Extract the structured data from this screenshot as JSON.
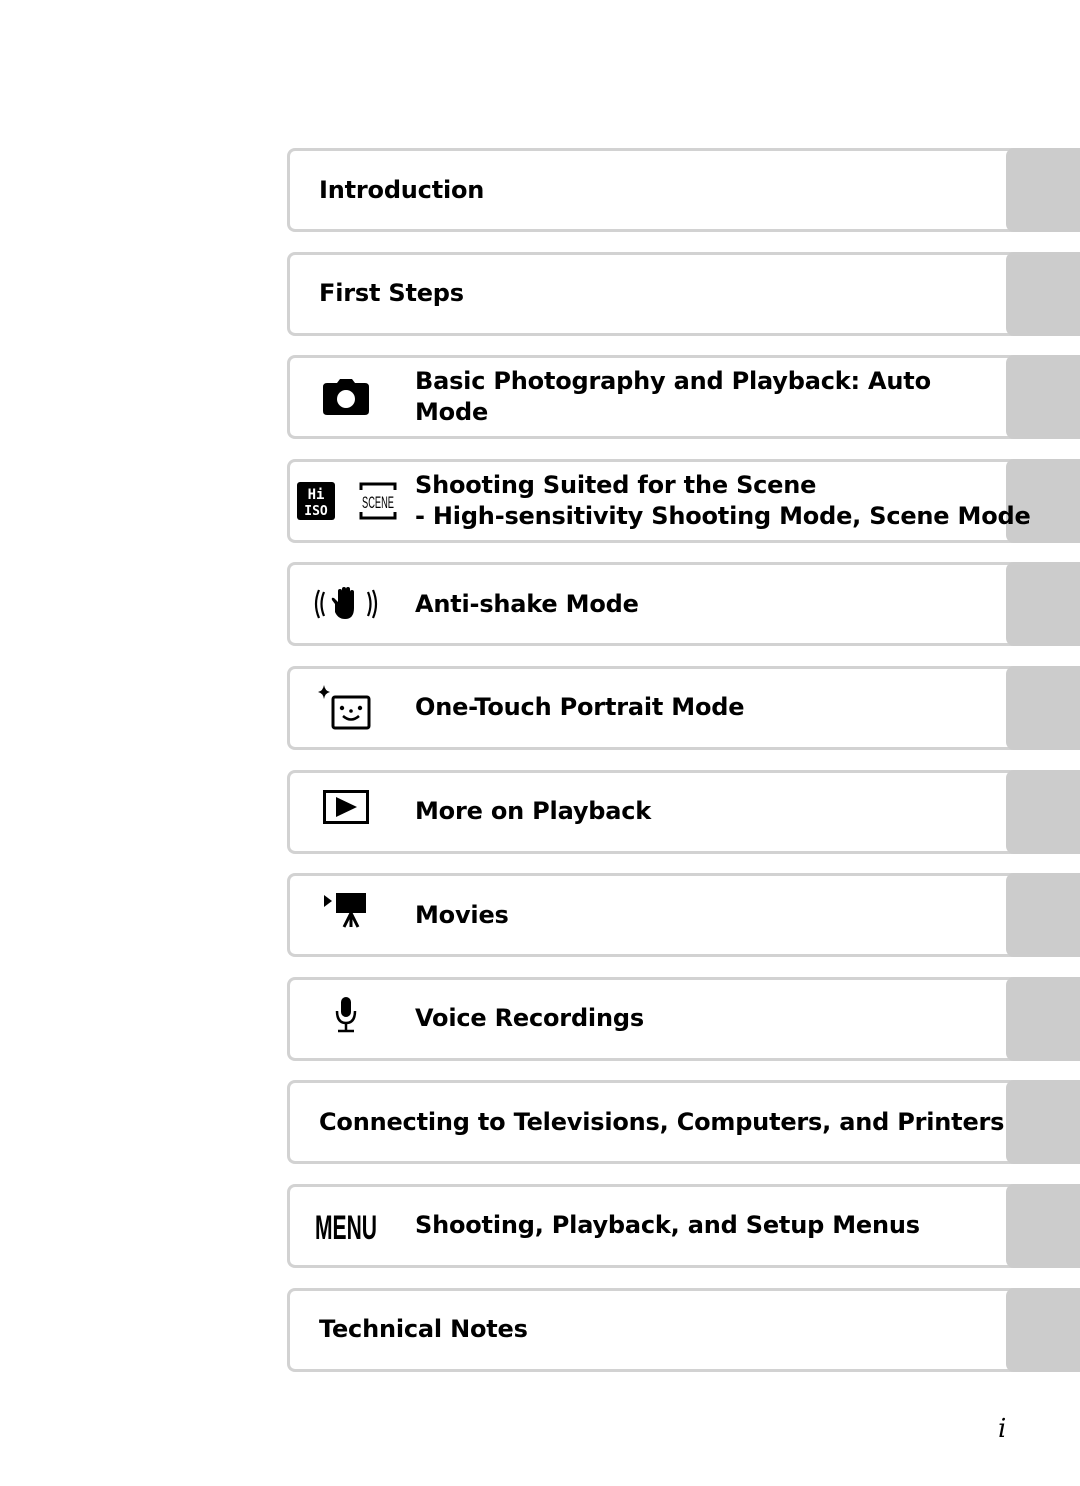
{
  "toc": {
    "entries": [
      {
        "title": "Introduction",
        "icon": null
      },
      {
        "title": "First Steps",
        "icon": null
      },
      {
        "title": "Basic Photography and Playback: Auto",
        "title2": "Mode",
        "icon": "camera-icon"
      },
      {
        "title": "Shooting Suited for the Scene",
        "title2": "- High-sensitivity Shooting Mode, Scene Mode",
        "icon": "hi-iso-scene-icon"
      },
      {
        "title": "Anti-shake Mode",
        "icon": "anti-shake-hand-icon"
      },
      {
        "title": "One-Touch Portrait Mode",
        "icon": "portrait-face-icon"
      },
      {
        "title": "More on Playback",
        "icon": "playback-icon"
      },
      {
        "title": "Movies",
        "icon": "movie-camera-icon"
      },
      {
        "title": "Voice Recordings",
        "icon": "microphone-icon"
      },
      {
        "title": "Connecting to Televisions, Computers, and Printers",
        "icon": null
      },
      {
        "title": "Shooting, Playback, and Setup Menus",
        "icon": "menu-icon"
      },
      {
        "title": "Technical Notes",
        "icon": null
      }
    ],
    "icon_texts": {
      "hi": "Hi",
      "iso": "ISO",
      "scene": "SCENE",
      "menu": "MENU"
    }
  },
  "page_number": "i",
  "colors": {
    "border": "#d2d2d2",
    "tab": "#cccccc"
  }
}
